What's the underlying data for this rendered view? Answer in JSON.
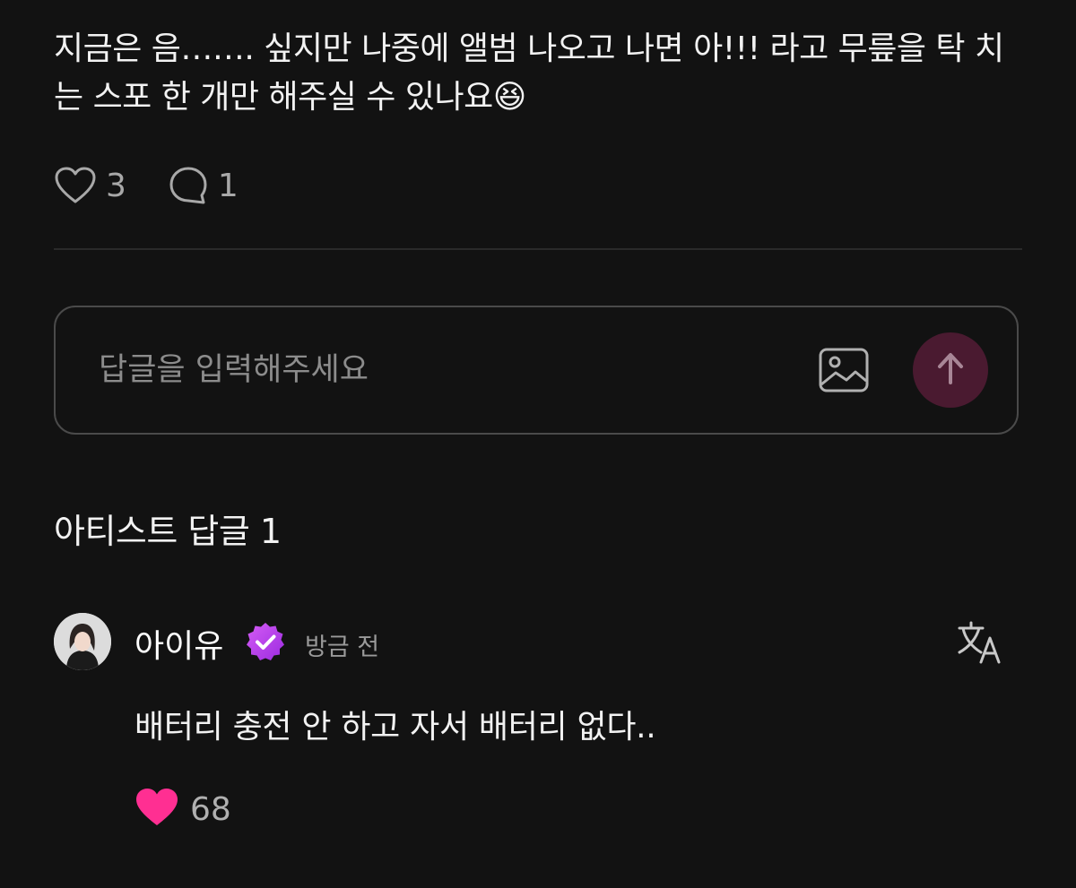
{
  "post": {
    "text": "지금은 음……. 싶지만 나중에 앨범 나오고 나면 아!!! 라고 무릎을 탁 치는  스포 한 개만 해주실 수 있나요",
    "emoji": "😆",
    "like_count": "3",
    "comment_count": "1"
  },
  "reply_box": {
    "placeholder": "답글을 입력해주세요"
  },
  "section": {
    "title": "아티스트 답글 1"
  },
  "comment": {
    "author": "아이유",
    "timestamp": "방금 전",
    "text": "배터리 충전 안 하고 자서 배터리 없다..",
    "like_count": "68"
  },
  "icons": {
    "like": "heart-outline-icon",
    "comment": "speech-bubble-icon",
    "image": "image-icon",
    "send": "arrow-up-icon",
    "verified": "verified-badge-icon",
    "translate": "translate-icon",
    "liked": "heart-filled-icon"
  },
  "colors": {
    "background": "#121212",
    "accent_pink": "#ff2f92",
    "verified_purple": "#b03cf0",
    "send_button": "#4a1a30"
  }
}
